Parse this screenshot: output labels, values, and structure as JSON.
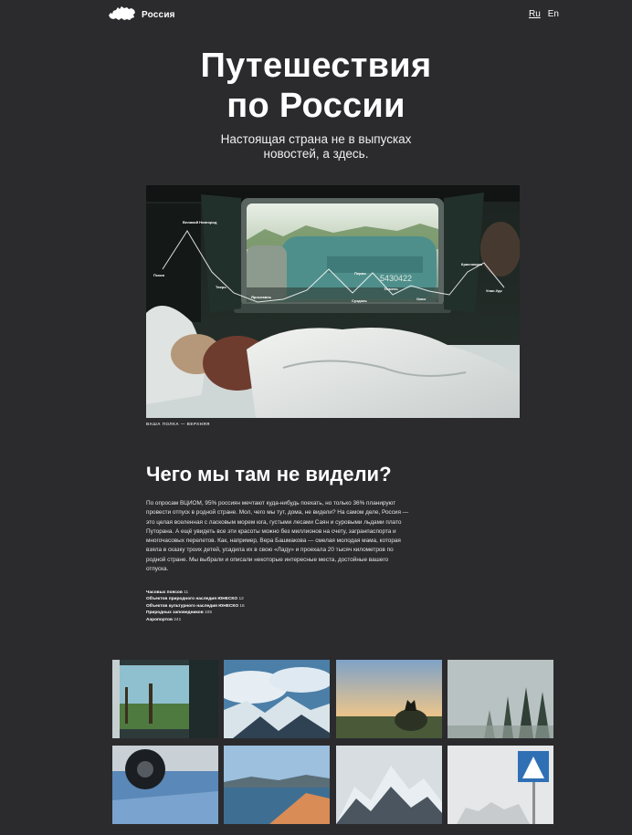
{
  "header": {
    "logo_text": "Россия",
    "languages": [
      "Ru",
      "En"
    ],
    "active_language": "Ru"
  },
  "hero": {
    "title_line1": "Путешествия",
    "title_line2": "по России",
    "subtitle_line1": "Настоящая страна не в выпусках",
    "subtitle_line2": "новостей, а здесь."
  },
  "photo": {
    "route_cities": [
      "Великий Новгород",
      "Псков",
      "Тверь",
      "Ярославль",
      "Пермь",
      "Суздаль",
      "Тюмень",
      "Омск",
      "Красноярск",
      "Улан-Удэ"
    ],
    "window_number": "5430422",
    "caption": "ВАША ПОЛКА — ВЕРХНЯЯ"
  },
  "article": {
    "section_title": "Чего мы там не видели?",
    "paragraph": "По опросам ВЦИОМ, 95% россиян мечтают куда-нибудь поехать, но только 36% планируют провести отпуск в родной стране. Мол, чего мы тут, дома, не видели? На самом деле, Россия — это целая вселенная с ласковым морем юга, густыми лесами Саян и суровыми льдами плато Путорана. А ещё увидеть все эти красоты можно без миллионов на счету, загранпаспорта и многочасовых перелетов. Как, например, Вера Башмакова — смелая молодая мама, которая взяла в сказку троих детей, усадила их в свою «Ладу» и проехала 20 тысяч километров по родной стране. Мы выбрали и описали некоторые интересные места, достойные вашего отпуска.",
    "facts": [
      {
        "label": "Часовых поясов",
        "value": "11"
      },
      {
        "label": "Объектов природного наследия ЮНЕСКО",
        "value": "12"
      },
      {
        "label": "Объектов культурного наследия ЮНЕСКО",
        "value": "16"
      },
      {
        "label": "Природных заповедников",
        "value": "105"
      },
      {
        "label": "Аэропортов",
        "value": "241"
      }
    ]
  },
  "gallery": {
    "tiles": [
      "train-window-photo",
      "clouds-mountains-photo",
      "wolf-sunset-photo",
      "foggy-forest-photo",
      "car-wheel-ice-photo",
      "beach-lake-photo",
      "snowy-peaks-photo",
      "crosswalk-sign-photo"
    ]
  },
  "colors": {
    "background": "#2b2b2e",
    "text": "#ffffff"
  }
}
